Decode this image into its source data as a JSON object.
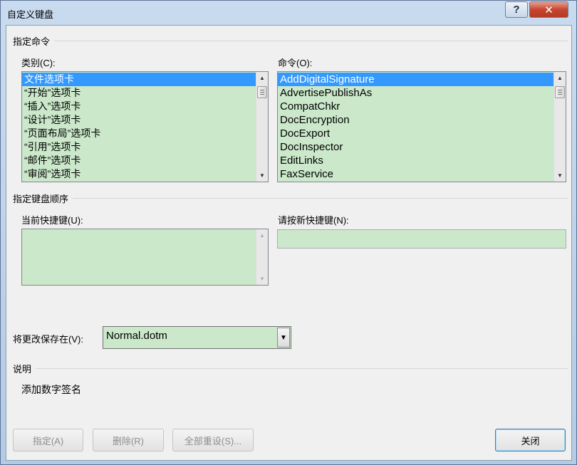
{
  "window": {
    "title": "自定义键盘",
    "help_glyph": "?",
    "close_glyph": "✕"
  },
  "specify_command": {
    "heading": "指定命令",
    "categories": {
      "label": "类别(C):",
      "items": [
        "文件选项卡",
        "“开始”选项卡",
        "“插入”选项卡",
        "“设计”选项卡",
        "“页面布局”选项卡",
        "“引用”选项卡",
        "“邮件”选项卡",
        "“审阅”选项卡"
      ],
      "selected_index": 0
    },
    "commands": {
      "label": "命令(O):",
      "items": [
        "AddDigitalSignature",
        "AdvertisePublishAs",
        "CompatChkr",
        "DocEncryption",
        "DocExport",
        "DocInspector",
        "EditLinks",
        "FaxService"
      ],
      "selected_index": 0
    }
  },
  "keyboard_sequence": {
    "heading": "指定键盘顺序",
    "current_keys_label": "当前快捷键(U):",
    "new_key_label": "请按新快捷键(N):",
    "new_key_value": ""
  },
  "save_in": {
    "label": "将更改保存在(V):",
    "value": "Normal.dotm"
  },
  "description": {
    "heading": "说明",
    "text": "添加数字签名"
  },
  "buttons": {
    "assign": "指定(A)",
    "remove": "删除(R)",
    "reset_all": "全部重设(S)...",
    "close": "关闭"
  },
  "colors": {
    "field_bg": "#cbe8cb",
    "selection": "#3399ff",
    "dialog_bg": "#f0f0f0"
  }
}
